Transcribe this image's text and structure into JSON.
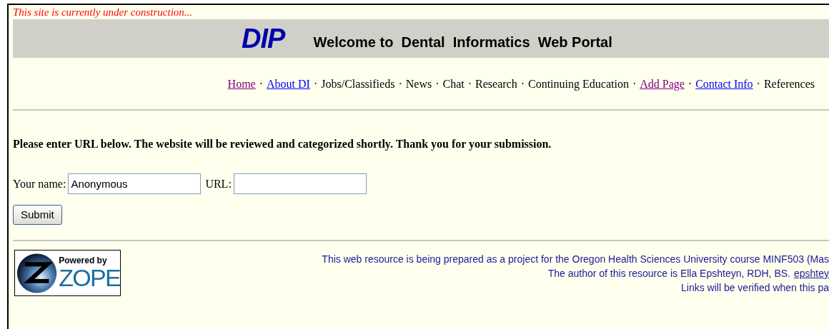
{
  "notice": "This site is currently under construction...",
  "banner": {
    "logo": "DIP",
    "title": "Welcome to  Dental  Informatics  Web Portal"
  },
  "nav": {
    "separator": "·",
    "items": [
      {
        "label": "Home",
        "kind": "visited-link"
      },
      {
        "label": "About DI",
        "kind": "link"
      },
      {
        "label": "Jobs/Classifieds",
        "kind": "text"
      },
      {
        "label": "News",
        "kind": "text"
      },
      {
        "label": "Chat",
        "kind": "text"
      },
      {
        "label": "Research",
        "kind": "text"
      },
      {
        "label": "Continuing Education",
        "kind": "text"
      },
      {
        "label": "Add Page",
        "kind": "visited-link"
      },
      {
        "label": "Contact Info",
        "kind": "link"
      },
      {
        "label": "References",
        "kind": "text"
      }
    ]
  },
  "instructions": "Please enter URL below. The website will be reviewed and categorized shortly. Thank you for your submission.",
  "form": {
    "name_label": "Your name:",
    "name_value": "Anonymous",
    "url_label": "URL:",
    "submit": "Submit"
  },
  "footer": {
    "badge_top": "Powered by",
    "badge_brand": "ZOPE",
    "line_1": "This web resource is being prepared as a project for the Oregon Health Sciences University course MINF503 (Mas",
    "line_2": "The author of this resource is Ella Epshteyn, RDH, BS.",
    "line_2_link": "epshtey",
    "line_3": "Links will be verified when this pa"
  }
}
